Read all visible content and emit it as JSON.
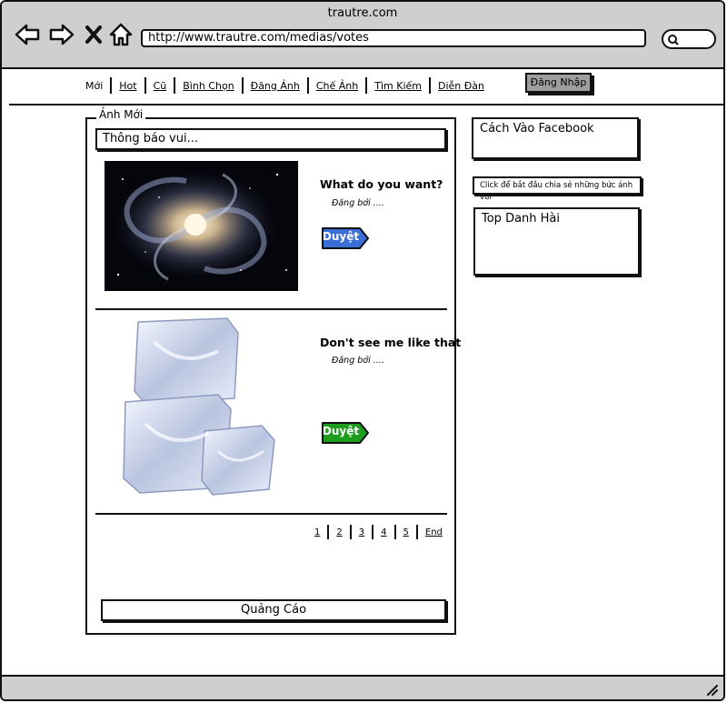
{
  "window": {
    "title": "trautre.com"
  },
  "browser": {
    "url": "http://www.trautre.com/medias/votes",
    "back_icon": "arrow-left-icon",
    "forward_icon": "arrow-right-icon",
    "close_icon": "x-icon",
    "home_icon": "home-icon",
    "search_icon": "search-icon"
  },
  "menu": {
    "items": [
      "Mới",
      "Hot",
      "Cũ",
      "Bình Chọn",
      "Đăng Ảnh",
      "Chế Ảnh",
      "Tìm Kiếm",
      "Diễn Đàn"
    ],
    "login_label": "Đăng Nhập"
  },
  "main": {
    "section_title": "Ảnh Mới",
    "notice": "Thông báo vui...",
    "posts": [
      {
        "title": "What do you want?",
        "posted_by": "Đăng bởi ....",
        "vote_label": "Duyệt",
        "vote_color": "#3a6fd8",
        "image": "galaxy"
      },
      {
        "title": "Don't see me like that",
        "posted_by": "Đăng bởi ....",
        "vote_label": "Duyệt",
        "vote_color": "#1e9e1e",
        "image": "ice-cubes"
      }
    ],
    "pagination": [
      "1",
      "2",
      "3",
      "4",
      "5",
      "End"
    ],
    "ad_label": "Quảng Cáo"
  },
  "sidebar": {
    "facebook_title": "Cách Vào Facebook",
    "share_text": "Click để bắt đầu chia sẻ những bức ảnh vui",
    "top_title": "Top Danh Hài"
  }
}
